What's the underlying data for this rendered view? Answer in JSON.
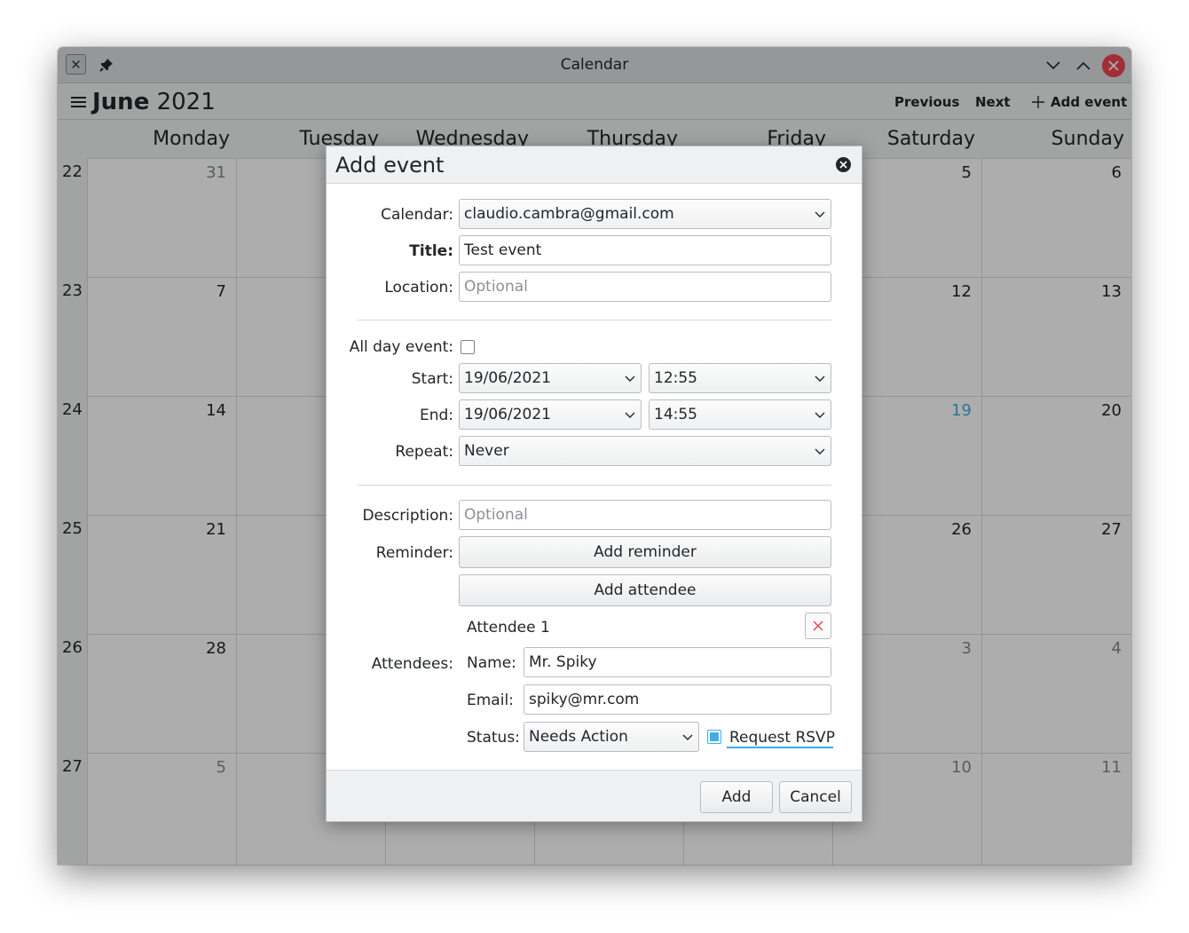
{
  "window": {
    "title": "Calendar"
  },
  "toolbar": {
    "month": "June",
    "year": "2021",
    "previous_label": "Previous",
    "next_label": "Next",
    "add_event_label": "Add event"
  },
  "calendar": {
    "days": [
      "Monday",
      "Tuesday",
      "Wednesday",
      "Thursday",
      "Friday",
      "Saturday",
      "Sunday"
    ],
    "weeks": [
      {
        "week": "22",
        "days": [
          "31",
          "",
          "",
          "",
          "",
          "5",
          "6"
        ]
      },
      {
        "week": "23",
        "days": [
          "7",
          "",
          "",
          "",
          "",
          "12",
          "13"
        ]
      },
      {
        "week": "24",
        "days": [
          "14",
          "",
          "",
          "",
          "",
          "19",
          "20"
        ]
      },
      {
        "week": "25",
        "days": [
          "21",
          "",
          "",
          "",
          "",
          "26",
          "27"
        ]
      },
      {
        "week": "26",
        "days": [
          "28",
          "",
          "",
          "",
          "",
          "3",
          "4"
        ]
      },
      {
        "week": "27",
        "days": [
          "5",
          "",
          "",
          "",
          "",
          "10",
          "11"
        ]
      }
    ],
    "today_color": "#3daee9",
    "dim_color": "#7f8c8d"
  },
  "dialog": {
    "title": "Add event",
    "calendar_label": "Calendar:",
    "calendar_value": "claudio.cambra@gmail.com",
    "title_label": "Title:",
    "title_value": "Test event",
    "location_label": "Location:",
    "location_placeholder": "Optional",
    "all_day_label": "All day event:",
    "start_label": "Start:",
    "start_date": "19/06/2021",
    "start_time": "12:55",
    "end_label": "End:",
    "end_date": "19/06/2021",
    "end_time": "14:55",
    "repeat_label": "Repeat:",
    "repeat_value": "Never",
    "description_label": "Description:",
    "description_placeholder": "Optional",
    "reminder_label": "Reminder:",
    "add_reminder_label": "Add reminder",
    "add_attendee_label": "Add attendee",
    "attendees_label": "Attendees:",
    "attendee": {
      "heading": "Attendee 1",
      "name_label": "Name:",
      "name_value": "Mr. Spiky",
      "email_label": "Email:",
      "email_value": "spiky@mr.com",
      "status_label": "Status:",
      "status_value": "Needs Action",
      "rsvp_label": "Request RSVP"
    },
    "add_button": "Add",
    "cancel_button": "Cancel"
  }
}
